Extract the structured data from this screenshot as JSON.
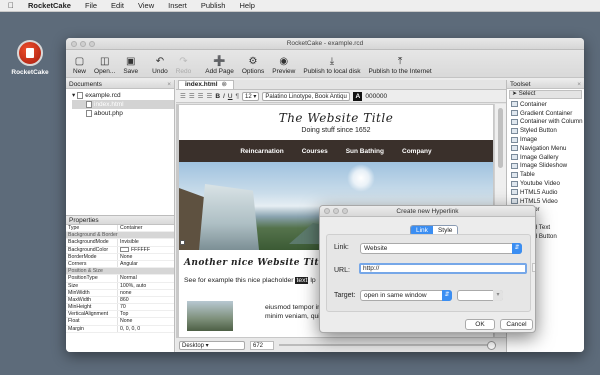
{
  "menubar": {
    "app": "RocketCake",
    "items": [
      "File",
      "Edit",
      "View",
      "Insert",
      "Publish",
      "Help"
    ]
  },
  "desktop_icon": {
    "label": "RocketCake"
  },
  "window": {
    "title": "RocketCake - example.rcd",
    "toolbar": [
      {
        "label": "New",
        "icon": "new-document-icon"
      },
      {
        "label": "Open...",
        "icon": "open-folder-icon"
      },
      {
        "label": "Save",
        "icon": "save-disk-icon"
      },
      {
        "label": "Undo",
        "icon": "undo-icon"
      },
      {
        "label": "Redo",
        "icon": "redo-icon"
      },
      {
        "label": "Add Page",
        "icon": "add-page-icon"
      },
      {
        "label": "Options",
        "icon": "gear-icon"
      },
      {
        "label": "Preview",
        "icon": "preview-eye-icon"
      },
      {
        "label": "Publish to local disk",
        "icon": "download-icon"
      },
      {
        "label": "Publish to the Internet",
        "icon": "upload-icon"
      }
    ]
  },
  "documents": {
    "title": "Documents",
    "root": "example.rcd",
    "files": [
      "index.html",
      "about.php"
    ]
  },
  "properties": {
    "title": "Properties",
    "rows": [
      {
        "k": "Type",
        "v": "Container",
        "section": false
      },
      {
        "k": "Background & Border",
        "v": "",
        "section": true
      },
      {
        "k": "BackgroundMode",
        "v": "Invisible",
        "section": false
      },
      {
        "k": "BackgroundColor",
        "v": "FFFFFF",
        "section": false,
        "swatch": true
      },
      {
        "k": "BorderMode",
        "v": "None",
        "section": false
      },
      {
        "k": "Corners",
        "v": "Angular",
        "section": false
      },
      {
        "k": "Position & Size",
        "v": "",
        "section": true
      },
      {
        "k": "PositionType",
        "v": "Normal",
        "section": false
      },
      {
        "k": "Size",
        "v": "100%, auto",
        "section": false
      },
      {
        "k": "MinWidth",
        "v": "none",
        "section": false
      },
      {
        "k": "MaxWidth",
        "v": "860",
        "section": false
      },
      {
        "k": "MinHeight",
        "v": "70",
        "section": false
      },
      {
        "k": "VerticalAlignment",
        "v": "Top",
        "section": false
      },
      {
        "k": "Float",
        "v": "None",
        "section": false
      },
      {
        "k": "Margin",
        "v": "0, 0, 0, 0",
        "section": false
      }
    ]
  },
  "editor": {
    "tab": "index.html",
    "format": {
      "bold": "B",
      "italic": "I",
      "underline": "U",
      "size": "12",
      "font": "Palatino Linotype, Book Antiqu",
      "color_label": "A",
      "color_value": "000000"
    },
    "page": {
      "title": "The Website Title",
      "subtitle": "Doing stuff since 1652",
      "nav": [
        "Reincarnation",
        "Courses",
        "Sun Bathing",
        "Company"
      ],
      "heading": "Another nice Website Title!",
      "paragraph_pre": "See for example this nice placholder",
      "paragraph_hl": "text",
      "paragraph_post": "lp",
      "lorem1": "eiusmod tempor inc",
      "lorem2": "minim veniam, quis"
    },
    "status": {
      "view": "Desktop",
      "width": "672"
    }
  },
  "toolset": {
    "title": "Toolset",
    "search": "Select",
    "items": [
      "Container",
      "Gradient Container",
      "Container with Column",
      "Styled Button",
      "Image",
      "Navigation Menu",
      "Image Gallery",
      "Image Slideshow",
      "Table",
      "Youtube Video",
      "HTML5 Audio",
      "HTML5 Video",
      "Anchor",
      "Text",
      "Styled Text",
      "Styled Button"
    ]
  },
  "dialog": {
    "title": "Create new Hyperlink",
    "tabs": [
      "Link",
      "Style"
    ],
    "active_tab": "Link",
    "link_label": "Link:",
    "link_value": "Website",
    "url_label": "URL:",
    "url_value": "http://",
    "target_label": "Target:",
    "target_value": "open in same window",
    "ok": "OK",
    "cancel": "Cancel"
  },
  "colors": {
    "accent": "#3b8ef2",
    "nav_bg": "#3a302b"
  }
}
